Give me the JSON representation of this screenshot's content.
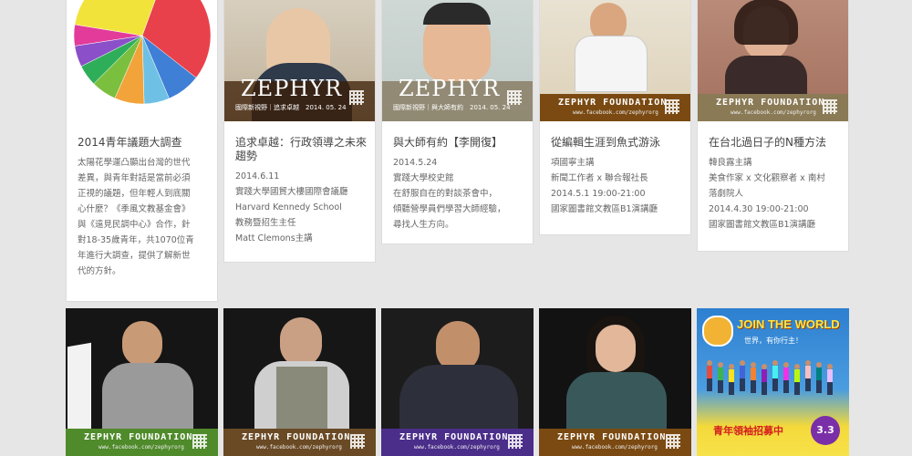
{
  "colors": {
    "page_bg": "#e6e6e6",
    "banner_brown": "#7a4a12",
    "banner_olive": "#8a7a55",
    "banner_green": "#4f8a2b",
    "banner_purple": "#4b2e8a",
    "banner_blue": "#1f3f8a"
  },
  "cards": [
    {
      "title": "2014青年議題大調查",
      "lines": [
        "太陽花學運凸顯出台灣的世代",
        "差異，與青年對話是當前必須",
        "正視的議題，但年輕人到底關",
        "心什麼？《季風文教基金會》",
        "與《遠見民調中心》合作，針",
        "對18-35歲青年，共1070位青",
        "年進行大調查，提供了解新世",
        "代的方針。"
      ],
      "chart_data": {
        "type": "pie",
        "values": [
          30,
          8,
          6,
          7,
          6,
          5,
          5,
          5,
          28
        ],
        "colors": [
          "#e8414b",
          "#3f7fd6",
          "#6ec1e4",
          "#f2a33a",
          "#7bbf3e",
          "#2fae5a",
          "#8b4fc9",
          "#e23b9a",
          "#f2e33a"
        ]
      }
    },
    {
      "title": "追求卓越：行政領導之未來趨勢",
      "lines": [
        "2014.6.11",
        "實踐大學國貿大樓國際會議廳",
        "Harvard Kennedy School",
        "教務暨招生主任",
        "Matt Clemons主講"
      ],
      "banner_big": "ZEPHYR",
      "banner_sub": "國際新視野｜追求卓越　2014. 05. 24"
    },
    {
      "title": "與大師有約【李開復】",
      "lines": [
        "2014.5.24",
        "實踐大學校史館",
        "在舒服自在的對談茶會中，",
        "傾聽營學員們學習大師經驗，",
        "尋找人生方向。"
      ],
      "banner_big": "ZEPHYR",
      "banner_sub": "國際新視野｜與大師有約　2014. 05. 24"
    },
    {
      "title": "從編輯生涯到魚式游泳",
      "lines": [
        "項國寧主講",
        "新聞工作者 x 聯合報社長",
        "2014.5.1 19:00-21:00",
        "國家圖書館文教區B1演講廳"
      ],
      "banner": "ZEPHYR FOUNDATION",
      "banner_url": "www.facebook.com/zephyrorg"
    },
    {
      "title": "在台北過日子的N種方法",
      "lines": [
        "韓良露主講",
        "美食作家 x 文化觀察者 x 南村",
        "落劇院人",
        "2014.4.30 19:00-21:00",
        "國家圖書館文教區B1演講廳"
      ],
      "banner": "ZEPHYR FOUNDATION",
      "banner_url": "www.facebook.com/zephyrorg"
    }
  ],
  "bottom_tiles": [
    {
      "banner": "ZEPHYR FOUNDATION",
      "banner_url": "www.facebook.com/zephyrorg"
    },
    {
      "banner": "ZEPHYR FOUNDATION",
      "banner_url": "www.facebook.com/zephyrorg"
    },
    {
      "banner": "ZEPHYR FOUNDATION",
      "banner_url": "www.facebook.com/zephyrorg"
    },
    {
      "banner": "ZEPHYR FOUNDATION",
      "banner_url": "www.facebook.com/zephyrorg"
    },
    {
      "headline": "JOIN THE WORLD",
      "tagline": "世界，有你行主！",
      "recruit": "青年領袖招募中",
      "date_badge": "3.3"
    }
  ]
}
